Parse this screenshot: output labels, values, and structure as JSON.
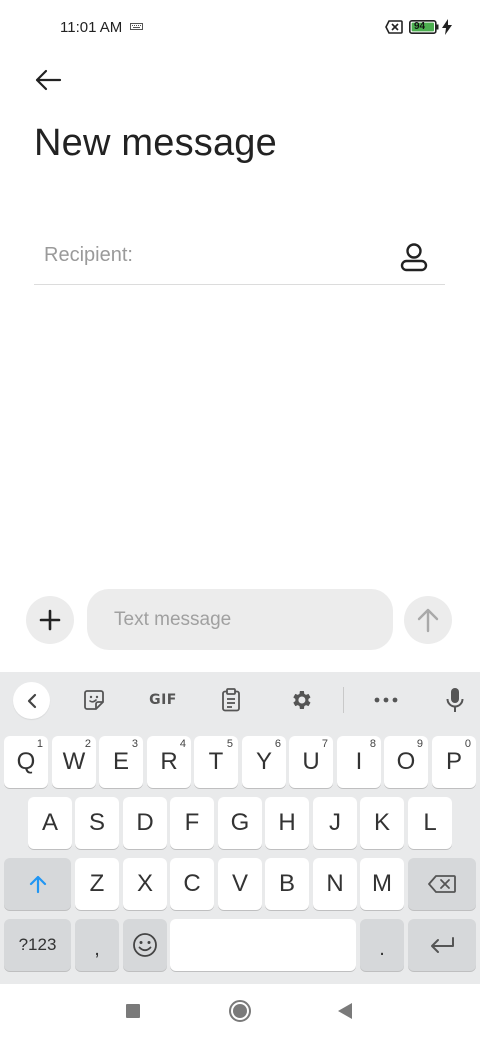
{
  "status_bar": {
    "time": "11:01 AM",
    "battery_level": "94",
    "battery_color": "#4caf50",
    "icons": [
      "keyboard-indicator-icon",
      "no-sim-icon",
      "battery-icon",
      "charging-bolt-icon"
    ]
  },
  "header": {
    "back_icon": "arrow-left-icon",
    "title": "New message"
  },
  "recipient": {
    "placeholder": "Recipient:",
    "contact_icon": "person-icon"
  },
  "compose": {
    "attach_icon": "plus-icon",
    "placeholder": "Text message",
    "send_icon": "arrow-up-icon"
  },
  "keyboard": {
    "toolbar": {
      "collapse_icon": "chevron-left-icon",
      "sticker_icon": "sticker-icon",
      "gif_label": "GIF",
      "clipboard_icon": "clipboard-icon",
      "settings_icon": "gear-icon",
      "more_icon": "more-horizontal-icon",
      "mic_icon": "microphone-icon"
    },
    "row1": [
      {
        "label": "Q",
        "sup": "1"
      },
      {
        "label": "W",
        "sup": "2"
      },
      {
        "label": "E",
        "sup": "3"
      },
      {
        "label": "R",
        "sup": "4"
      },
      {
        "label": "T",
        "sup": "5"
      },
      {
        "label": "Y",
        "sup": "6"
      },
      {
        "label": "U",
        "sup": "7"
      },
      {
        "label": "I",
        "sup": "8"
      },
      {
        "label": "O",
        "sup": "9"
      },
      {
        "label": "P",
        "sup": "0"
      }
    ],
    "row2": [
      "A",
      "S",
      "D",
      "F",
      "G",
      "H",
      "J",
      "K",
      "L"
    ],
    "row3": [
      "Z",
      "X",
      "C",
      "V",
      "B",
      "N",
      "M"
    ],
    "shift_icon": "shift-arrow-icon",
    "backspace_icon": "backspace-icon",
    "symbols_label": "?123",
    "comma_label": ",",
    "emoji_icon": "emoji-icon",
    "period_label": ".",
    "enter_icon": "enter-icon",
    "accent_color": "#2196f3"
  },
  "nav_bar": {
    "recent_icon": "recent-apps-icon",
    "home_icon": "home-icon",
    "back_icon": "back-triangle-icon"
  }
}
